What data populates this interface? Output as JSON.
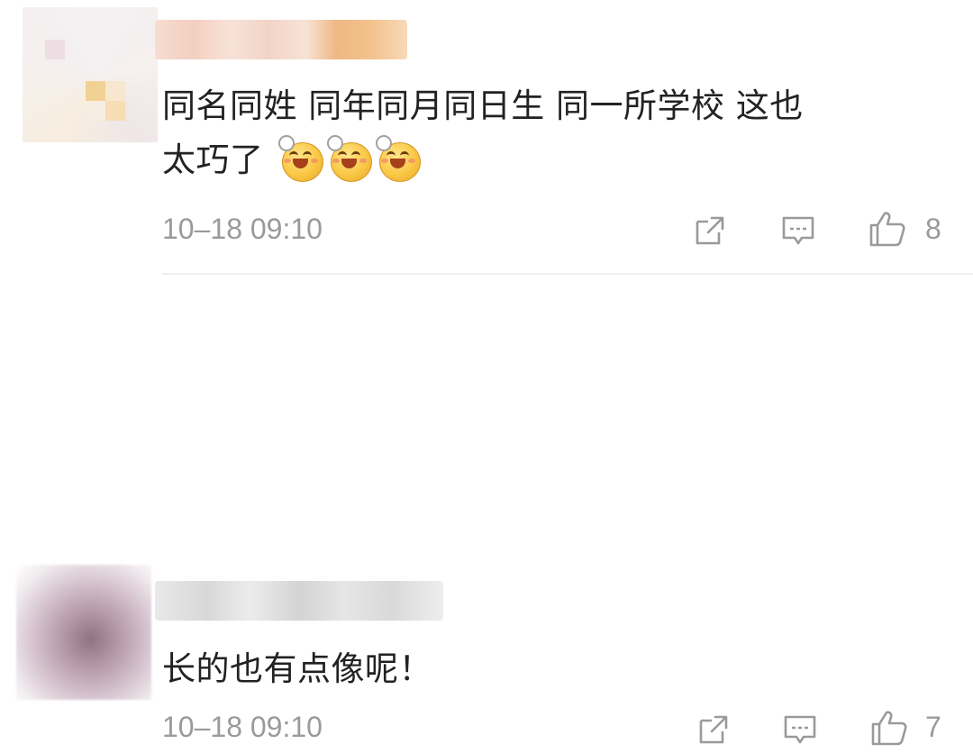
{
  "comments": [
    {
      "text_line1": "同名同姓 同年同月同日生 同一所学校 这也",
      "text_line2": "太巧了",
      "emojis": [
        "blush-smile-emoji",
        "blush-smile-emoji",
        "blush-smile-emoji"
      ],
      "time": "10–18 09:10",
      "likes": "8"
    },
    {
      "text": "长的也有点像呢！",
      "time": "10–18 09:10",
      "likes": "7"
    }
  ],
  "icons": {
    "share": "share-icon",
    "comment": "comment-icon",
    "like": "thumbs-up-icon"
  },
  "colors": {
    "meta_text": "#9a9a9a",
    "divider": "#eeeeee"
  }
}
